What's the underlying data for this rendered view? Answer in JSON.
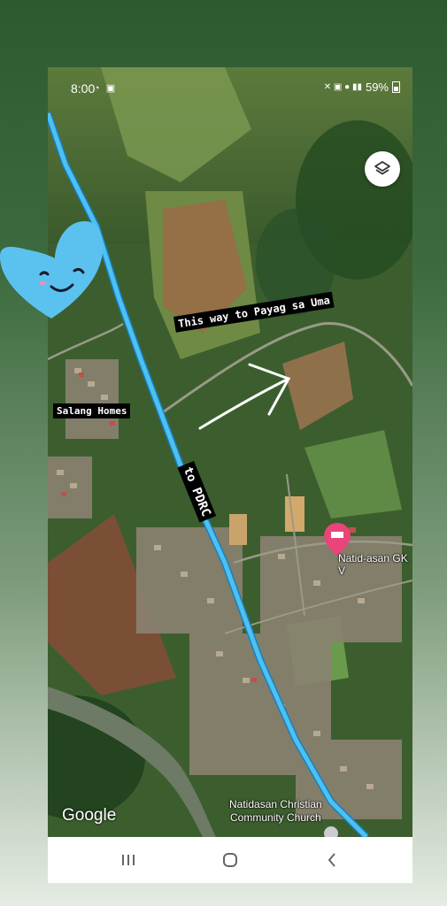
{
  "status_bar": {
    "time": "8:00",
    "battery": "59%"
  },
  "labels": {
    "payag": "This way to Payag sa Uma",
    "salang": "Salang Homes",
    "pdrc": "to PDRC"
  },
  "places": {
    "natid_asan": "Natid-asan GK V",
    "church_line1": "Natidasan Christian",
    "church_line2": "Community Church"
  },
  "attribution": "Google",
  "icons": {
    "layers": "layers-icon",
    "place_pin": "map-pin-icon",
    "heart": "heart-sticker",
    "arrow": "arrow-sticker"
  },
  "colors": {
    "route": "#2fa8e8",
    "route_outline": "#1a7fc0",
    "pin": "#e8457a",
    "heart": "#5bc2f0"
  }
}
